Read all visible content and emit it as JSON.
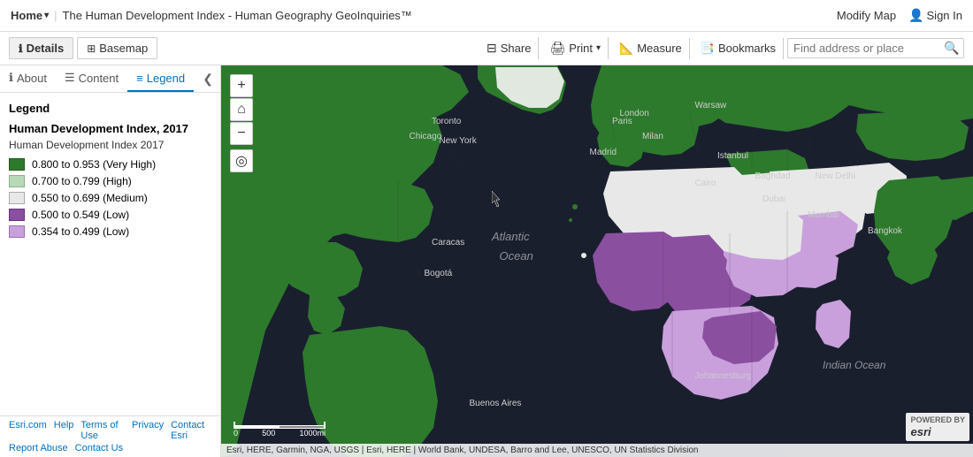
{
  "topbar": {
    "home_label": "Home",
    "home_arrow": "▾",
    "page_title": "The Human Development Index - Human Geography GeoInquiries™",
    "modify_map_label": "Modify Map",
    "sign_in_label": "Sign In"
  },
  "toolbar": {
    "details_label": "Details",
    "basemap_label": "Basemap",
    "share_label": "Share",
    "print_label": "Print",
    "print_arrow": "▾",
    "measure_label": "Measure",
    "bookmarks_label": "Bookmarks",
    "search_placeholder": "Find address or place"
  },
  "sidebar": {
    "about_label": "About",
    "content_label": "Content",
    "legend_label": "Legend",
    "legend_heading": "Legend",
    "layer_title": "Human Development Index, 2017",
    "layer_subtitle": "Human Development Index 2017",
    "legend_items": [
      {
        "label": "0.800 to 0.953 (Very High)",
        "color": "#2d7a2d",
        "border": "#1a5c1a"
      },
      {
        "label": "0.700 to 0.799 (High)",
        "color": "#b8d9b8",
        "border": "#8ab08a"
      },
      {
        "label": "0.550 to 0.699 (Medium)",
        "color": "#e8e8e8",
        "border": "#aaa"
      },
      {
        "label": "0.500 to 0.549 (Low)",
        "color": "#8b4fa0",
        "border": "#6b3080"
      },
      {
        "label": "0.354 to 0.499 (Low)",
        "color": "#c9a0dc",
        "border": "#9b70b0"
      }
    ]
  },
  "map": {
    "attribution": "Esri, HERE, Garmin, NGA, USGS | Esri, HERE | World Bank, UNDESA, Barro and Lee, UNESCO, UN Statistics Division",
    "esri_label": "POWERED BY esri",
    "scale_labels": [
      "0",
      "500",
      "1000mi"
    ],
    "ocean_labels": [
      {
        "text": "Atlantic",
        "top": "42%",
        "left": "40%"
      },
      {
        "text": "Ocean",
        "top": "47%",
        "left": "40.5%"
      },
      {
        "text": "Indian Ocean",
        "top": "78%",
        "left": "81%"
      }
    ],
    "city_labels": [
      {
        "text": "London",
        "top": "11%",
        "left": "53%"
      },
      {
        "text": "Paris",
        "top": "14%",
        "left": "53%"
      },
      {
        "text": "Milan",
        "top": "18%",
        "left": "57%"
      },
      {
        "text": "Madrid",
        "top": "21%",
        "left": "50%"
      },
      {
        "text": "Warsaw",
        "top": "10%",
        "left": "65%"
      },
      {
        "text": "Istanbul",
        "top": "22%",
        "left": "67%"
      },
      {
        "text": "Baghdad",
        "top": "27%",
        "left": "72%"
      },
      {
        "text": "Cairo",
        "top": "29%",
        "left": "65%"
      },
      {
        "text": "Dubai",
        "top": "33%",
        "left": "73%"
      },
      {
        "text": "New Delhi",
        "top": "28%",
        "left": "79%"
      },
      {
        "text": "Mumbai",
        "top": "38%",
        "left": "78%"
      },
      {
        "text": "Bangkok",
        "top": "41%",
        "left": "86%"
      },
      {
        "text": "Toronto",
        "top": "14%",
        "left": "29%"
      },
      {
        "text": "New York",
        "top": "19%",
        "left": "31%"
      },
      {
        "text": "Chicago",
        "top": "18%",
        "left": "27%"
      },
      {
        "text": "Bogota",
        "top": "54%",
        "left": "28%"
      },
      {
        "text": "Caracas",
        "top": "45%",
        "left": "31%"
      },
      {
        "text": "Buenos Aires",
        "top": "85%",
        "left": "36%"
      },
      {
        "text": "Johannesburg",
        "top": "78%",
        "left": "65%"
      }
    ]
  },
  "footer": {
    "links": [
      {
        "label": "Esri.com"
      },
      {
        "label": "Help"
      },
      {
        "label": "Terms of Use"
      },
      {
        "label": "Privacy"
      },
      {
        "label": "Contact Esri"
      },
      {
        "label": "Report Abuse"
      },
      {
        "label": "Contact Us"
      }
    ]
  },
  "icons": {
    "home": "🏠",
    "user": "👤",
    "share": "📎",
    "print": "🖨",
    "measure": "📏",
    "bookmarks": "🔖",
    "search": "🔍",
    "info": "ℹ",
    "content": "☰",
    "legend": "☰",
    "zoom_in": "+",
    "zoom_out": "−",
    "home_map": "⌂",
    "locate": "◎",
    "chevron": "❮"
  }
}
